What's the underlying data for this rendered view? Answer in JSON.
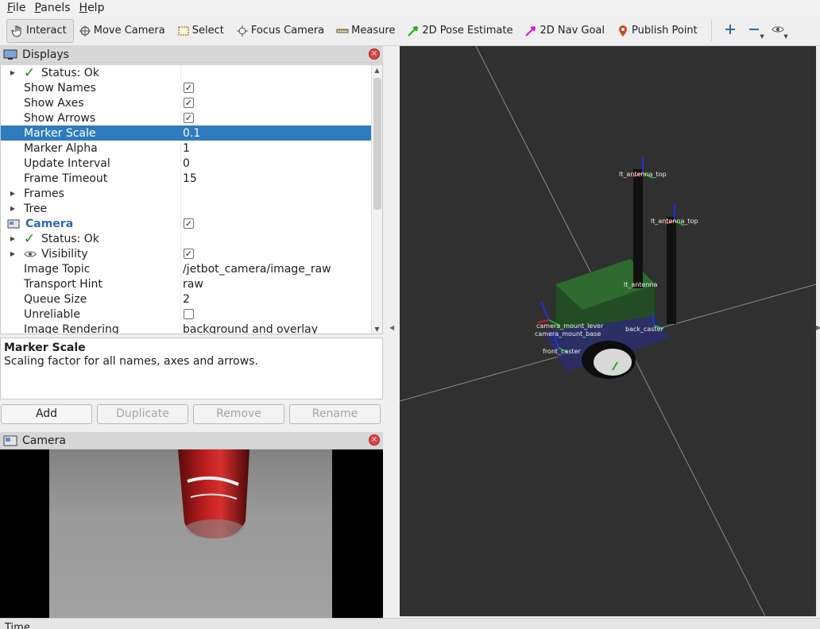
{
  "menu": [
    {
      "label": "File",
      "mnemonic": "F",
      "rest": "ile"
    },
    {
      "label": "Panels",
      "mnemonic": "P",
      "rest": "anels"
    },
    {
      "label": "Help",
      "mnemonic": "H",
      "rest": "elp"
    }
  ],
  "toolbar": {
    "interact": "Interact",
    "move_camera": "Move Camera",
    "select": "Select",
    "focus_camera": "Focus Camera",
    "measure": "Measure",
    "pose_estimate": "2D Pose Estimate",
    "nav_goal": "2D Nav Goal",
    "publish_point": "Publish Point"
  },
  "displays_panel": {
    "title": "Displays",
    "rows": [
      {
        "label": "Status: Ok",
        "value": ""
      },
      {
        "label": "Show Names",
        "value": ""
      },
      {
        "label": "Show Axes",
        "value": ""
      },
      {
        "label": "Show Arrows",
        "value": ""
      },
      {
        "label": "Marker Scale",
        "value": "0.1"
      },
      {
        "label": "Marker Alpha",
        "value": "1"
      },
      {
        "label": "Update Interval",
        "value": "0"
      },
      {
        "label": "Frame Timeout",
        "value": "15"
      },
      {
        "label": "Frames",
        "value": ""
      },
      {
        "label": "Tree",
        "value": ""
      },
      {
        "label": "Camera",
        "value": ""
      },
      {
        "label": "Status: Ok",
        "value": ""
      },
      {
        "label": "Visibility",
        "value": ""
      },
      {
        "label": "Image Topic",
        "value": "/jetbot_camera/image_raw"
      },
      {
        "label": "Transport Hint",
        "value": "raw"
      },
      {
        "label": "Queue Size",
        "value": "2"
      },
      {
        "label": "Unreliable",
        "value": ""
      },
      {
        "label": "Image Rendering",
        "value": "background and overlay"
      }
    ],
    "checked_mark": "✓"
  },
  "description": {
    "title": "Marker Scale",
    "text": "Scaling factor for all names, axes and arrows."
  },
  "buttons": {
    "add": "Add",
    "duplicate": "Duplicate",
    "remove": "Remove",
    "rename": "Rename"
  },
  "camera_panel": {
    "title": "Camera"
  },
  "viewport": {
    "frame_labels": [
      "lt_antenna_top",
      "lt_antenna_top",
      "lt_antenna",
      "camera_mount_base",
      "camera_mount_lever",
      "back_caster",
      "front_caster"
    ]
  },
  "bottom_bar": {
    "text": "Time"
  },
  "colors": {
    "selection": "#2e7bbf",
    "camera_label": "#2e6ab0",
    "viewport_bg": "#303030",
    "robot_body": "#2a5a2a",
    "antenna": "#111111"
  }
}
